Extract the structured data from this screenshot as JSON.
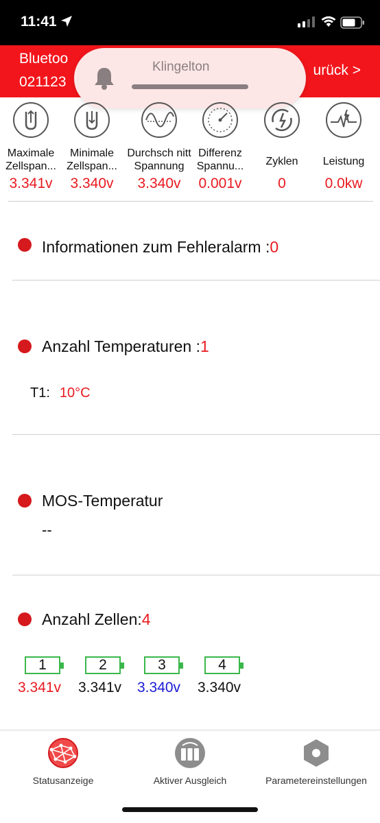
{
  "status_bar": {
    "time": "11:41"
  },
  "header": {
    "title": "Bluetoo",
    "device_id": "021123",
    "back_label": "urück >"
  },
  "notification": {
    "label": "Klingelton"
  },
  "metrics": [
    {
      "label": "Maximale Zellspan...",
      "value": "3.341v",
      "icon": "max-cell-voltage-icon"
    },
    {
      "label": "Minimale Zellspan...",
      "value": "3.340v",
      "icon": "min-cell-voltage-icon"
    },
    {
      "label": "Durchsch nitt Spannung",
      "value": "3.340v",
      "icon": "sine-wave-icon"
    },
    {
      "label": "Differenz Spannu...",
      "value": "0.001v",
      "icon": "gauge-icon"
    },
    {
      "label": "Zyklen",
      "value": "0",
      "icon": "cycle-icon"
    },
    {
      "label": "Leistung",
      "value": "0.0kw",
      "icon": "power-pulse-icon"
    }
  ],
  "fault_alarm": {
    "label": "Informationen zum Fehleralarm :",
    "count": "0"
  },
  "temperatures": {
    "label": "Anzahl Temperaturen :",
    "count": "1",
    "items": [
      {
        "name": "T1:",
        "value": "10°C"
      }
    ]
  },
  "mos": {
    "label": "MOS-Temperatur",
    "value": "--"
  },
  "cells": {
    "label": "Anzahl Zellen:",
    "count": "4",
    "items": [
      {
        "index": "1",
        "voltage": "3.341v",
        "color": "#e8191f"
      },
      {
        "index": "2",
        "voltage": "3.341v",
        "color": "#111111"
      },
      {
        "index": "3",
        "voltage": "3.340v",
        "color": "#1a1ad6"
      },
      {
        "index": "4",
        "voltage": "3.340v",
        "color": "#111111"
      }
    ]
  },
  "tabs": [
    {
      "label": "Statusanzeige",
      "icon": "globe-network-icon",
      "active": true
    },
    {
      "label": "Aktiver Ausgleich",
      "icon": "battery-balance-icon",
      "active": false
    },
    {
      "label": "Parametereinstellungen",
      "icon": "hexagon-settings-icon",
      "active": false
    }
  ],
  "colors": {
    "accent": "#f2151b",
    "value_red": "#e8191f",
    "battery_green": "#3ab74a",
    "cell_blue": "#1a1ad6"
  }
}
